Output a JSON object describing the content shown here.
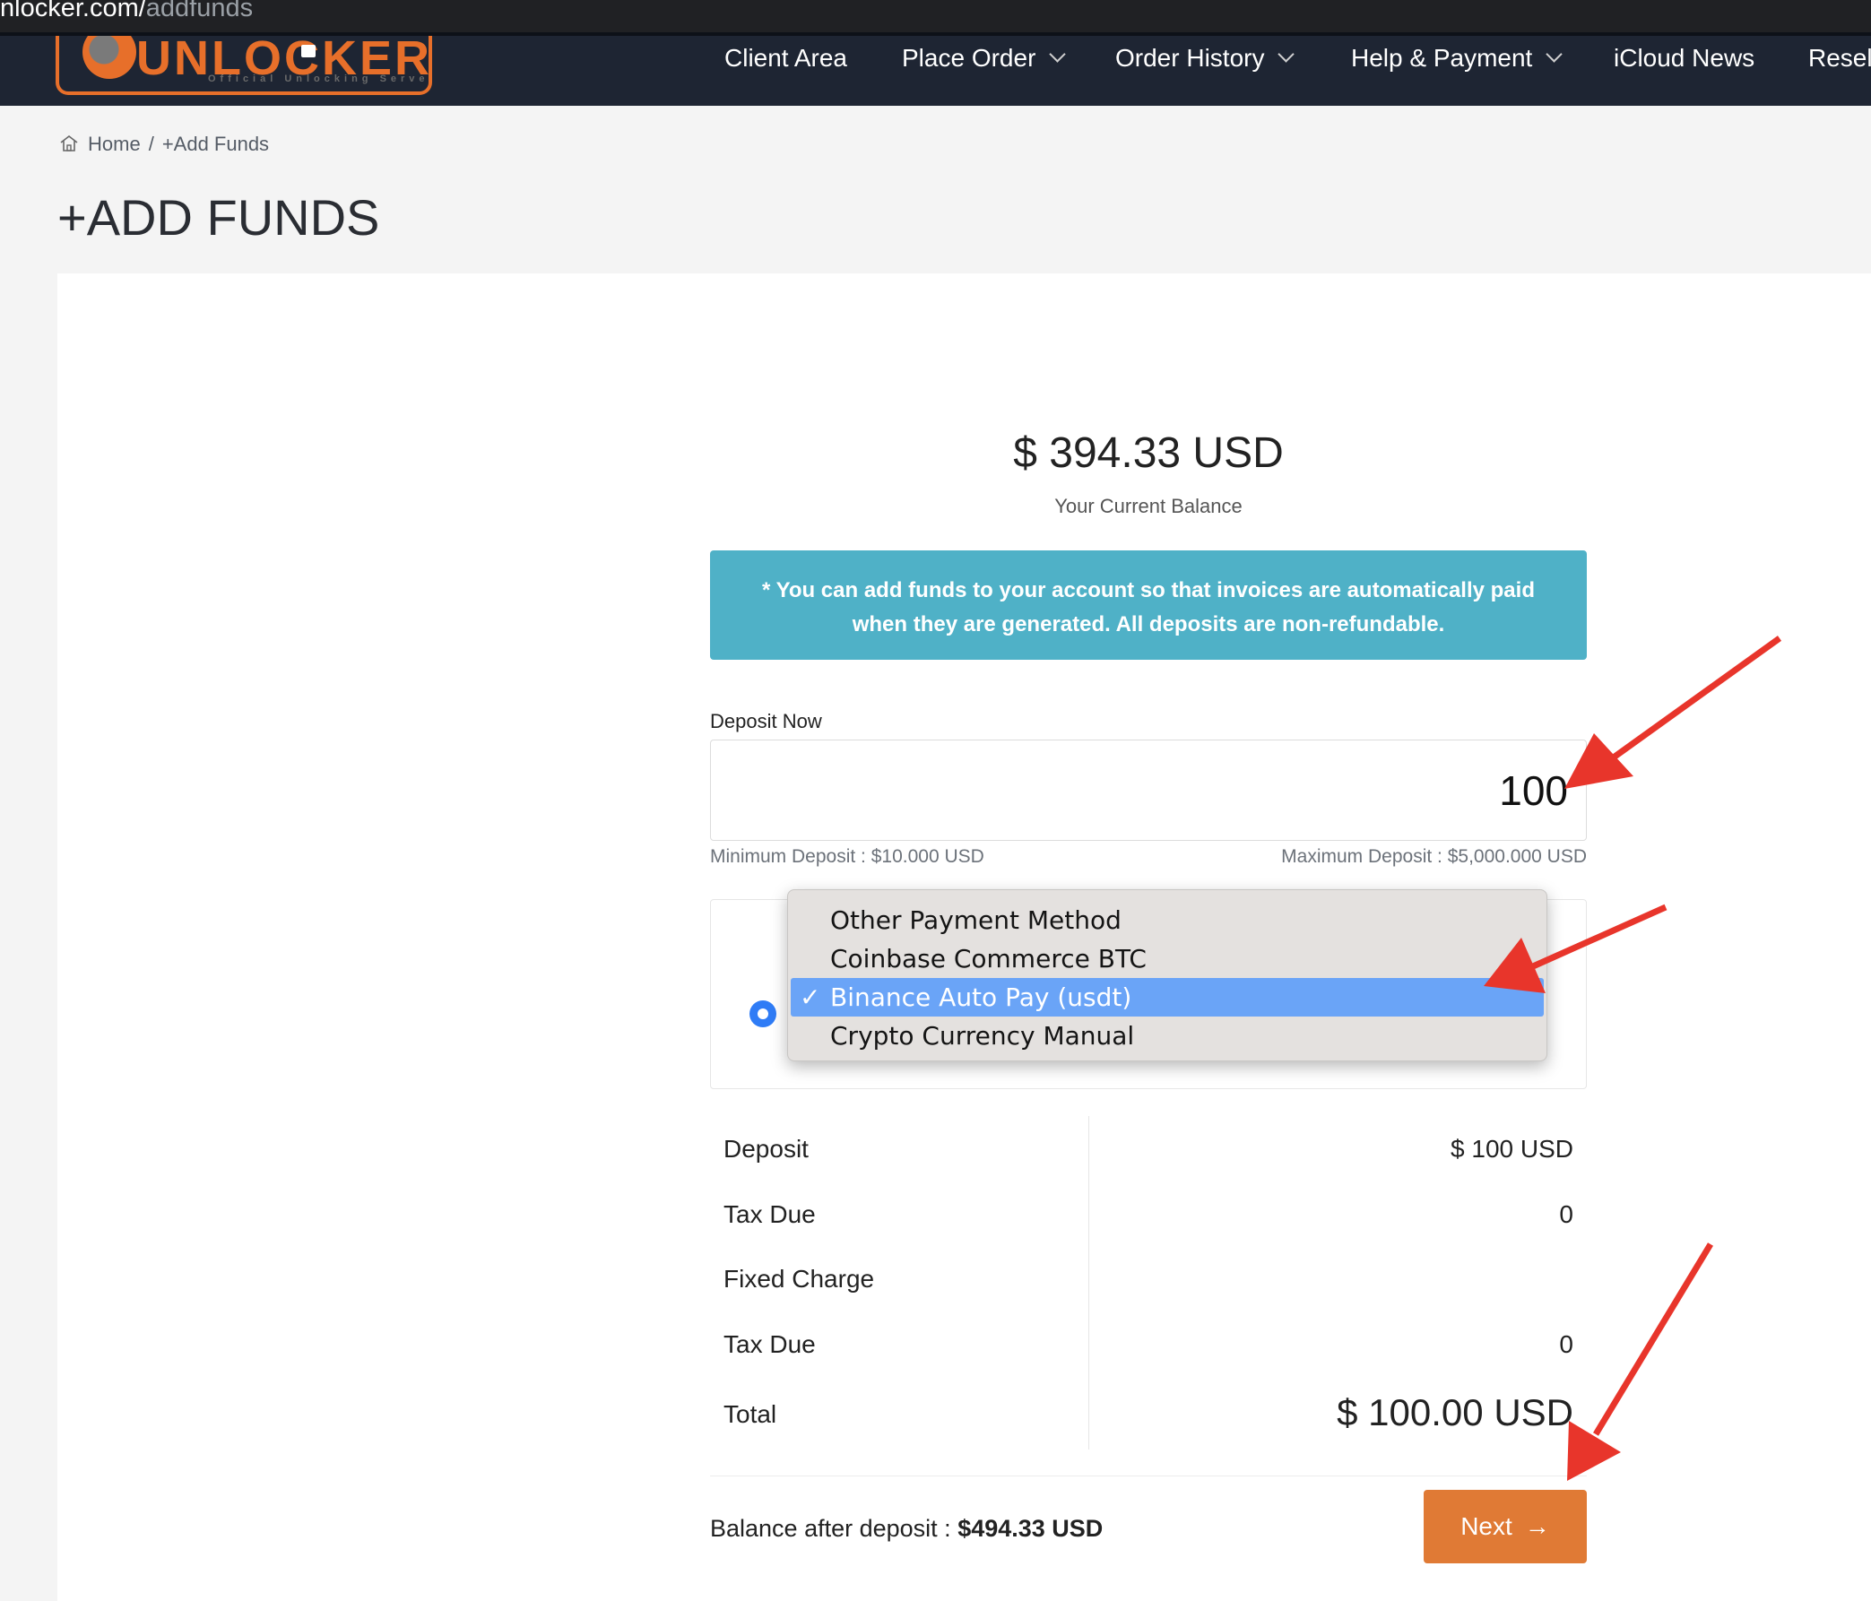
{
  "browser": {
    "url_host": "nlocker.com/",
    "url_path": "addfunds"
  },
  "logo": {
    "wordmark": "UNLOCKER",
    "tagline": "Official Unlocking Server"
  },
  "nav": {
    "items": [
      {
        "label": "Client Area",
        "has_menu": false
      },
      {
        "label": "Place Order",
        "has_menu": true
      },
      {
        "label": "Order History",
        "has_menu": true
      },
      {
        "label": "Help & Payment",
        "has_menu": true
      },
      {
        "label": "iCloud News",
        "has_menu": false
      },
      {
        "label": "Resell",
        "has_menu": false
      }
    ]
  },
  "breadcrumb": {
    "home": "Home",
    "separator": "/",
    "current": "+Add Funds"
  },
  "page": {
    "title": "+ADD FUNDS"
  },
  "balance": {
    "amount": "$ 394.33 USD",
    "label": "Your Current Balance"
  },
  "notice": {
    "text": "* You can add funds to your account so that invoices are automatically paid when they are generated. All deposits are non-refundable."
  },
  "deposit": {
    "label": "Deposit Now",
    "value": "100",
    "min_text": "Minimum Deposit : $10.000 USD",
    "max_text": "Maximum Deposit : $5,000.000 USD"
  },
  "payment_methods": {
    "options": [
      {
        "label": "Other Payment Method",
        "selected": false
      },
      {
        "label": "Coinbase Commerce BTC",
        "selected": false
      },
      {
        "label": "Binance Auto Pay (usdt)",
        "selected": true
      },
      {
        "label": "Crypto Currency Manual",
        "selected": false
      }
    ],
    "check_glyph": "✓"
  },
  "summary": {
    "rows": [
      {
        "label": "Deposit",
        "value": "$ 100 USD"
      },
      {
        "label": "Tax Due",
        "value": "0"
      },
      {
        "label": "Fixed Charge",
        "value": ""
      },
      {
        "label": "Tax Due",
        "value": "0"
      },
      {
        "label": "Total",
        "value": "$ 100.00 USD"
      }
    ]
  },
  "footer": {
    "balance_after_label": "Balance after deposit :",
    "balance_after_value": "$494.33 USD",
    "next_label": "Next",
    "next_arrow": "→"
  },
  "colors": {
    "nav_bg": "#1e2533",
    "brand_orange": "#e76f2a",
    "notice_bg": "#4fb1c7",
    "selected_option": "#6aa4f7",
    "radio_blue": "#2f7cf6",
    "next_button": "#e07a35",
    "annotation_red": "#e8352b"
  },
  "icons": {
    "home": "home-icon",
    "chevron": "chevron-down-icon",
    "arrow": "arrow-right-icon"
  }
}
